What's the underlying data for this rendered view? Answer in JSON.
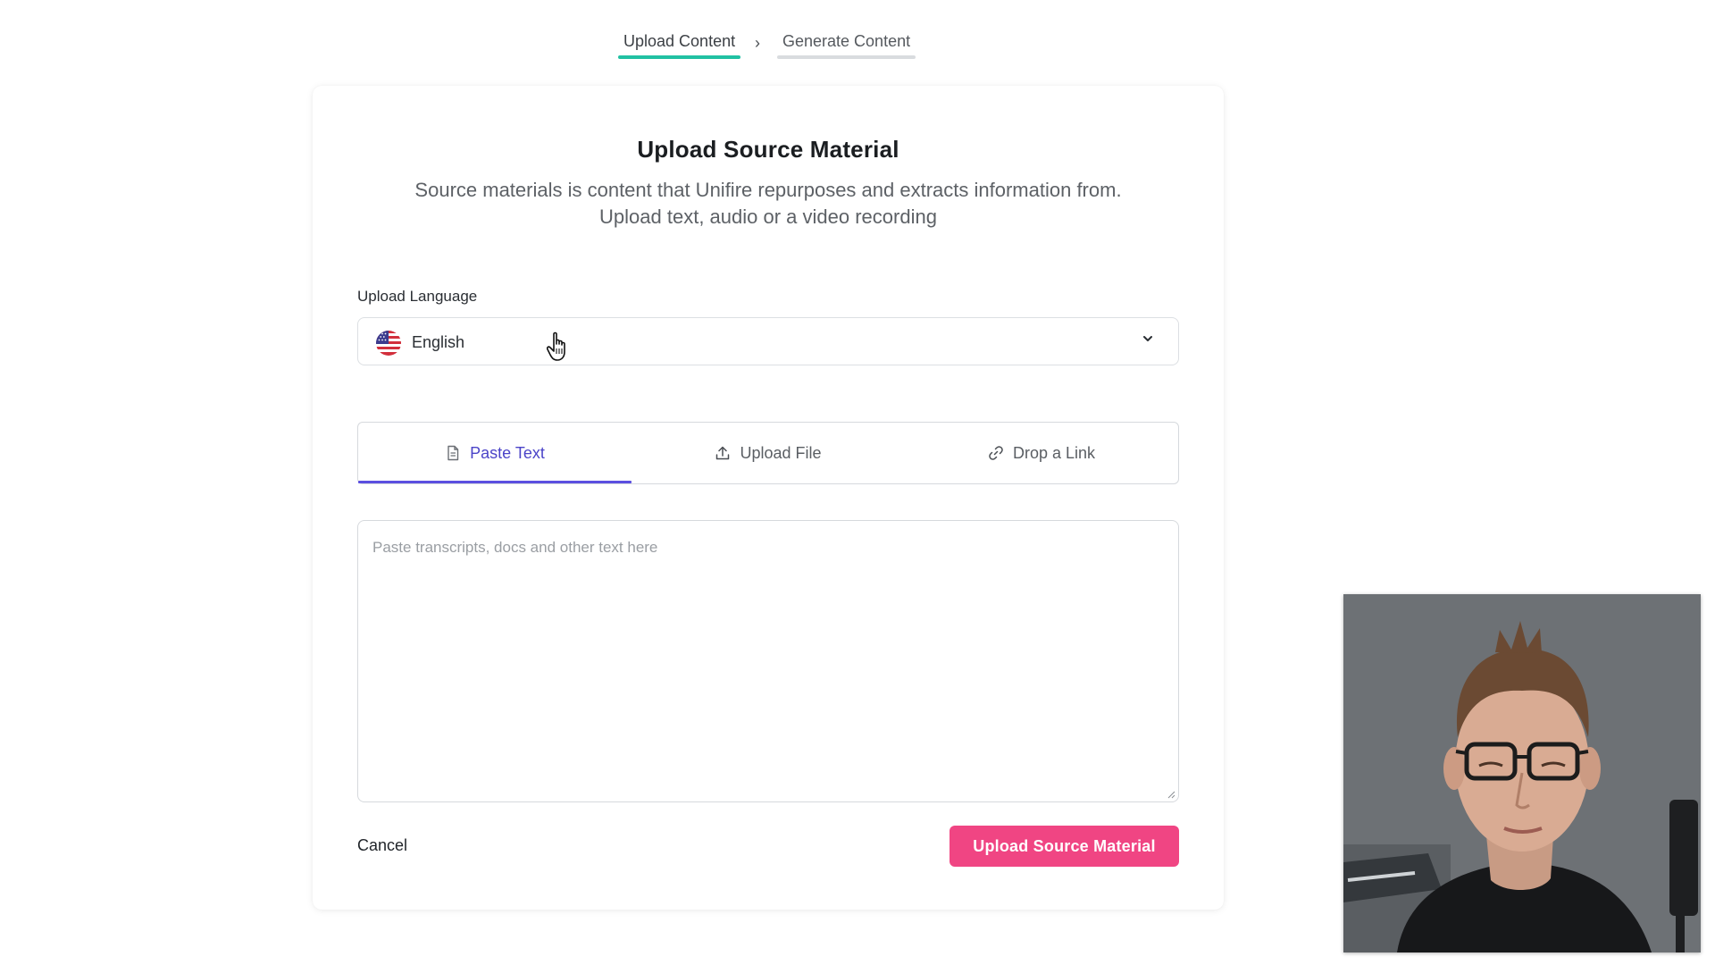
{
  "stepper": {
    "steps": [
      {
        "label": "Upload Content",
        "active": true
      },
      {
        "label": "Generate Content",
        "active": false
      }
    ]
  },
  "card": {
    "title": "Upload Source Material",
    "subtitle_line1": "Source materials is content that Unifire repurposes and extracts information from.",
    "subtitle_line2": "Upload text, audio or a video recording"
  },
  "language": {
    "label": "Upload Language",
    "value": "English",
    "flag_icon": "us-flag-icon"
  },
  "tabs": [
    {
      "label": "Paste Text",
      "icon": "document-icon",
      "active": true
    },
    {
      "label": "Upload File",
      "icon": "upload-icon",
      "active": false
    },
    {
      "label": "Drop a Link",
      "icon": "link-icon",
      "active": false
    }
  ],
  "textarea": {
    "placeholder": "Paste transcripts, docs and other text here",
    "value": ""
  },
  "actions": {
    "cancel_label": "Cancel",
    "submit_label": "Upload Source Material"
  },
  "colors": {
    "accent_primary": "#f04583",
    "tab_active": "#5b4fe0",
    "step_active": "#21c1a3"
  }
}
